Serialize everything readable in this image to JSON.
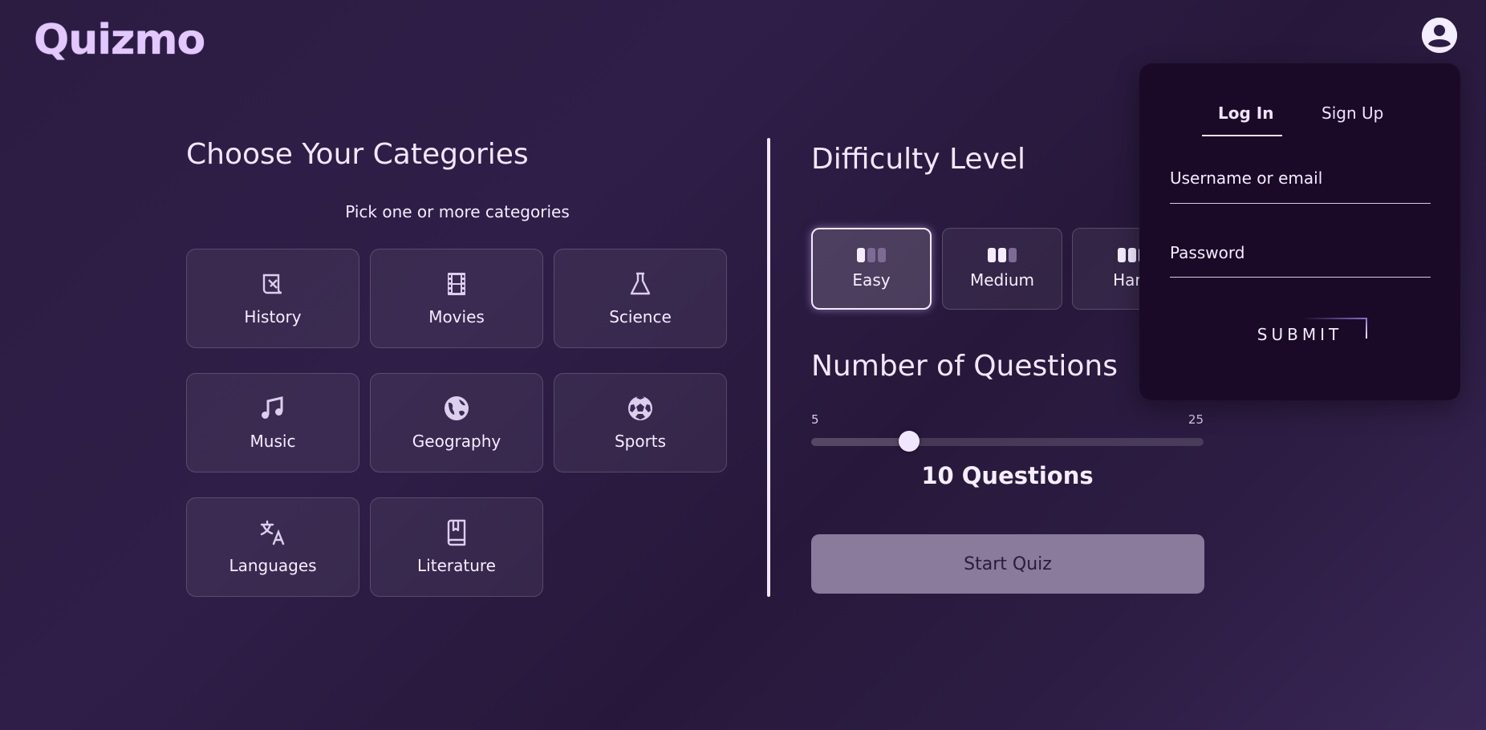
{
  "header": {
    "logo": "Quizmo",
    "account_icon": "account-circle-icon"
  },
  "categories": {
    "title": "Choose Your Categories",
    "subtitle": "Pick one or more categories",
    "items": [
      {
        "label": "History",
        "icon": "history-scroll-icon"
      },
      {
        "label": "Movies",
        "icon": "film-strip-icon"
      },
      {
        "label": "Science",
        "icon": "flask-icon"
      },
      {
        "label": "Music",
        "icon": "music-note-icon"
      },
      {
        "label": "Geography",
        "icon": "globe-icon"
      },
      {
        "label": "Sports",
        "icon": "soccer-ball-icon"
      },
      {
        "label": "Languages",
        "icon": "translate-icon"
      },
      {
        "label": "Literature",
        "icon": "book-icon"
      }
    ]
  },
  "difficulty": {
    "title": "Difficulty Level",
    "selected": "Easy",
    "options": [
      {
        "label": "Easy",
        "level": 1
      },
      {
        "label": "Medium",
        "level": 2
      },
      {
        "label": "Hard",
        "level": 3
      }
    ]
  },
  "questions": {
    "title": "Number of Questions",
    "min": 5,
    "max": 25,
    "min_label": "5",
    "max_label": "25",
    "value": 10,
    "count_label": "10 Questions"
  },
  "start_button": "Start Quiz",
  "auth": {
    "tab_login": "Log In",
    "tab_signup": "Sign Up",
    "active_tab": "Log In",
    "username_label": "Username or email",
    "password_label": "Password",
    "submit_label": "SUBMIT"
  }
}
